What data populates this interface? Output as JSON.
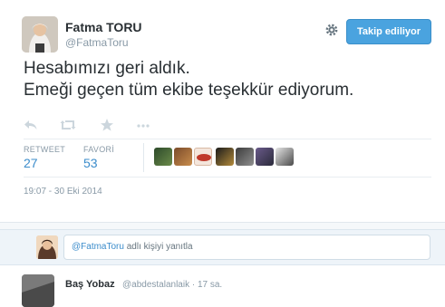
{
  "tweet": {
    "fullname": "Fatma TORU",
    "username": "@FatmaToru",
    "follow_label": "Takip ediliyor",
    "text_line1": "Hesabımızı geri aldık.",
    "text_line2": "Emeği geçen tüm ekibe teşekkür ediyorum.",
    "stats": {
      "retweet_label": "RETWEET",
      "retweet_count": "27",
      "favorite_label": "FAVORİ",
      "favorite_count": "53"
    },
    "favoriters": [
      "avatar-1",
      "avatar-2",
      "avatar-3",
      "avatar-4",
      "avatar-5",
      "avatar-6",
      "avatar-7"
    ],
    "timestamp": "19:07 - 30 Eki 2014"
  },
  "reply": {
    "mention": "@FatmaToru",
    "suffix": " adlı kişiyi yanıtla"
  },
  "next_tweet": {
    "fullname": "Baş Yobaz",
    "meta": "@abdestalanlaik · 17 sa."
  },
  "colors": {
    "accent": "#4aa3df",
    "link": "#3b8ccb",
    "muted": "#8899a6",
    "text": "#292f33"
  }
}
